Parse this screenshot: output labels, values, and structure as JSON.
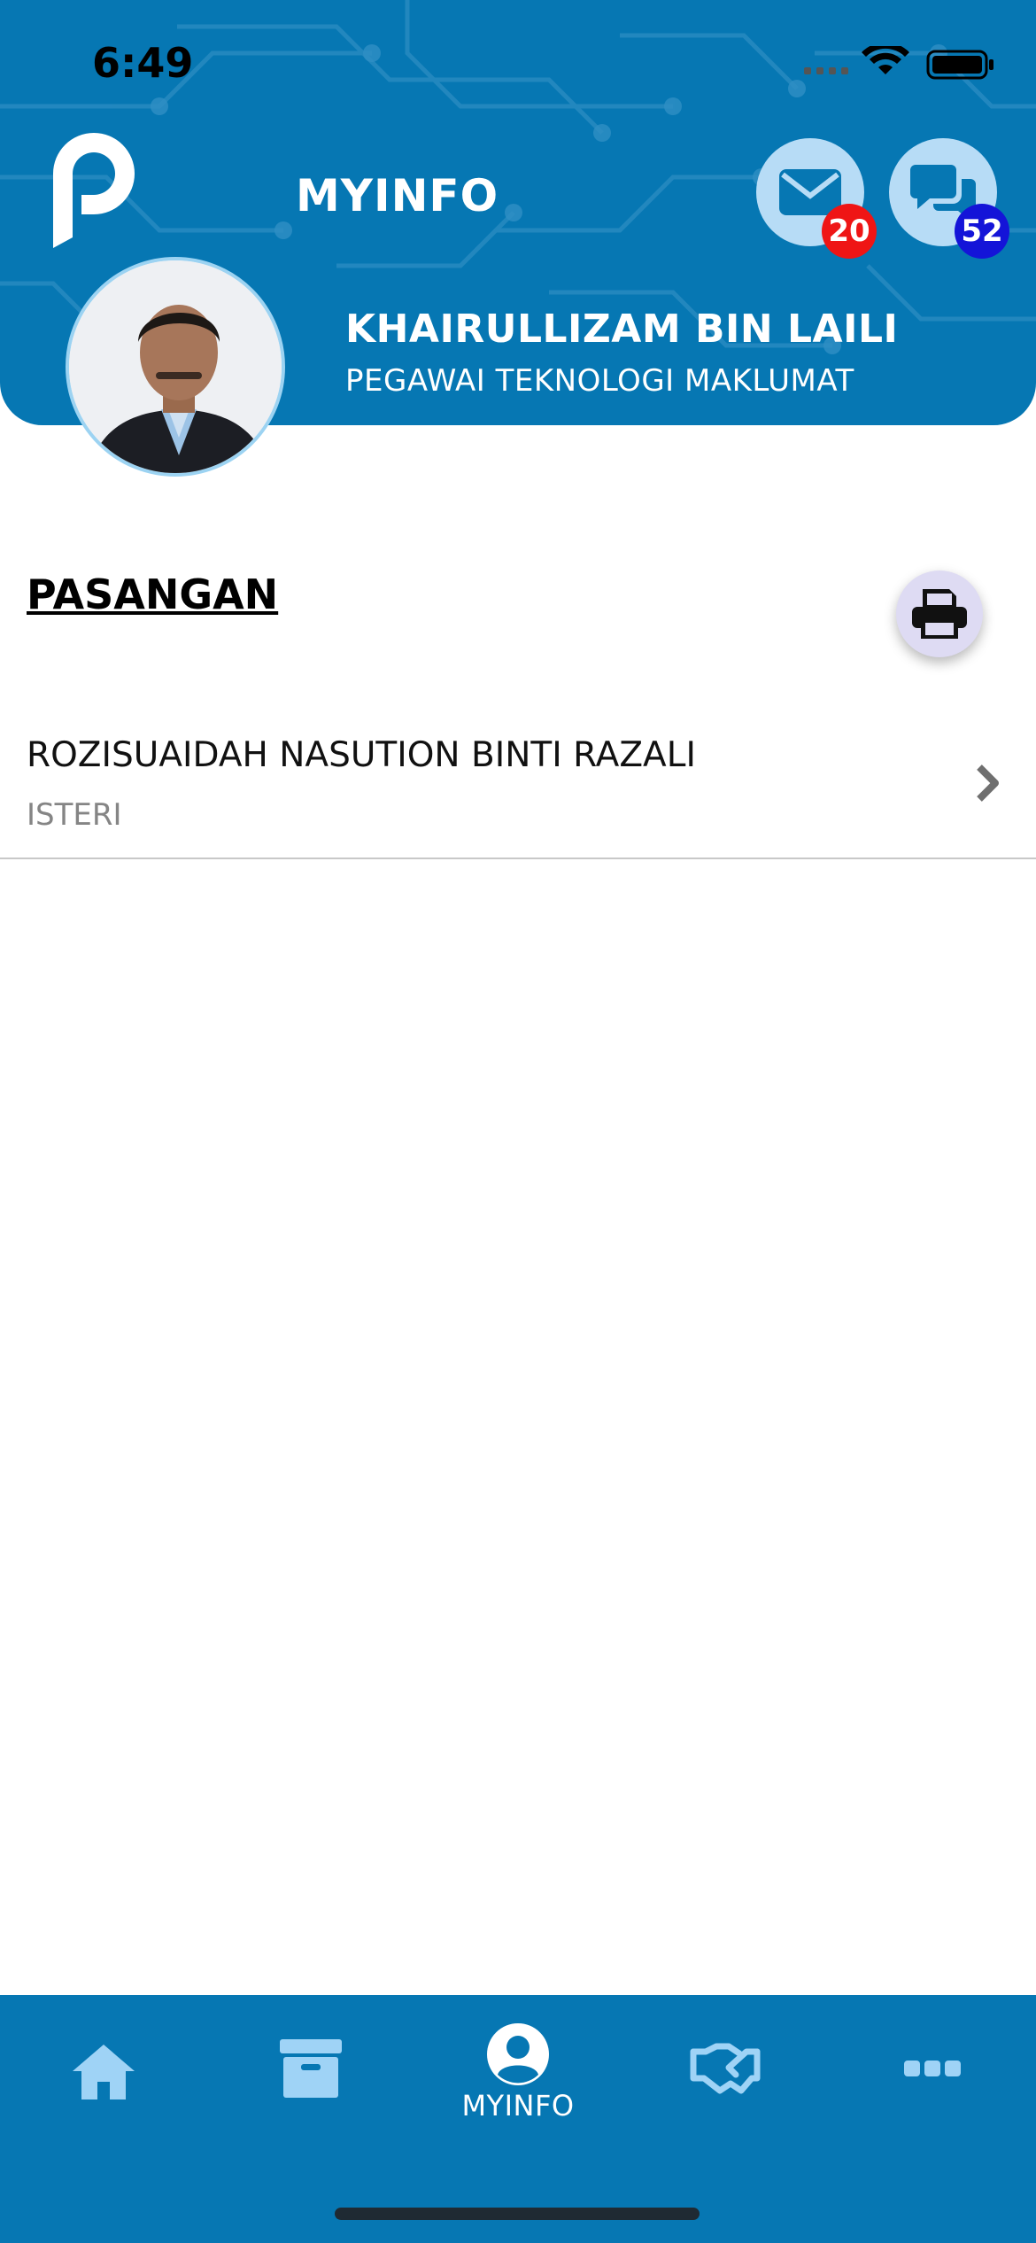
{
  "status_bar": {
    "time": "6:49"
  },
  "header": {
    "title": "MYINFO",
    "mail_badge": "20",
    "chat_badge": "52"
  },
  "user": {
    "name": "KHAIRULLIZAM BIN LAILI",
    "role": "PEGAWAI TEKNOLOGI MAKLUMAT"
  },
  "section": {
    "title": "PASANGAN",
    "items": [
      {
        "name": "ROZISUAIDAH NASUTION BINTI RAZALI",
        "relation": "ISTERI"
      }
    ]
  },
  "tabbar": {
    "tabs": [
      {
        "icon": "home-icon",
        "label": ""
      },
      {
        "icon": "archive-icon",
        "label": ""
      },
      {
        "icon": "user-icon",
        "label": "MYINFO",
        "active": true
      },
      {
        "icon": "handshake-icon",
        "label": ""
      },
      {
        "icon": "more-icon",
        "label": ""
      }
    ]
  },
  "colors": {
    "primary": "#0677b3",
    "icon_bg": "#b7dcf6",
    "mail_badge": "#ef1515",
    "chat_badge": "#1414d8",
    "inactive_tab_icon": "#9fd3f6"
  }
}
